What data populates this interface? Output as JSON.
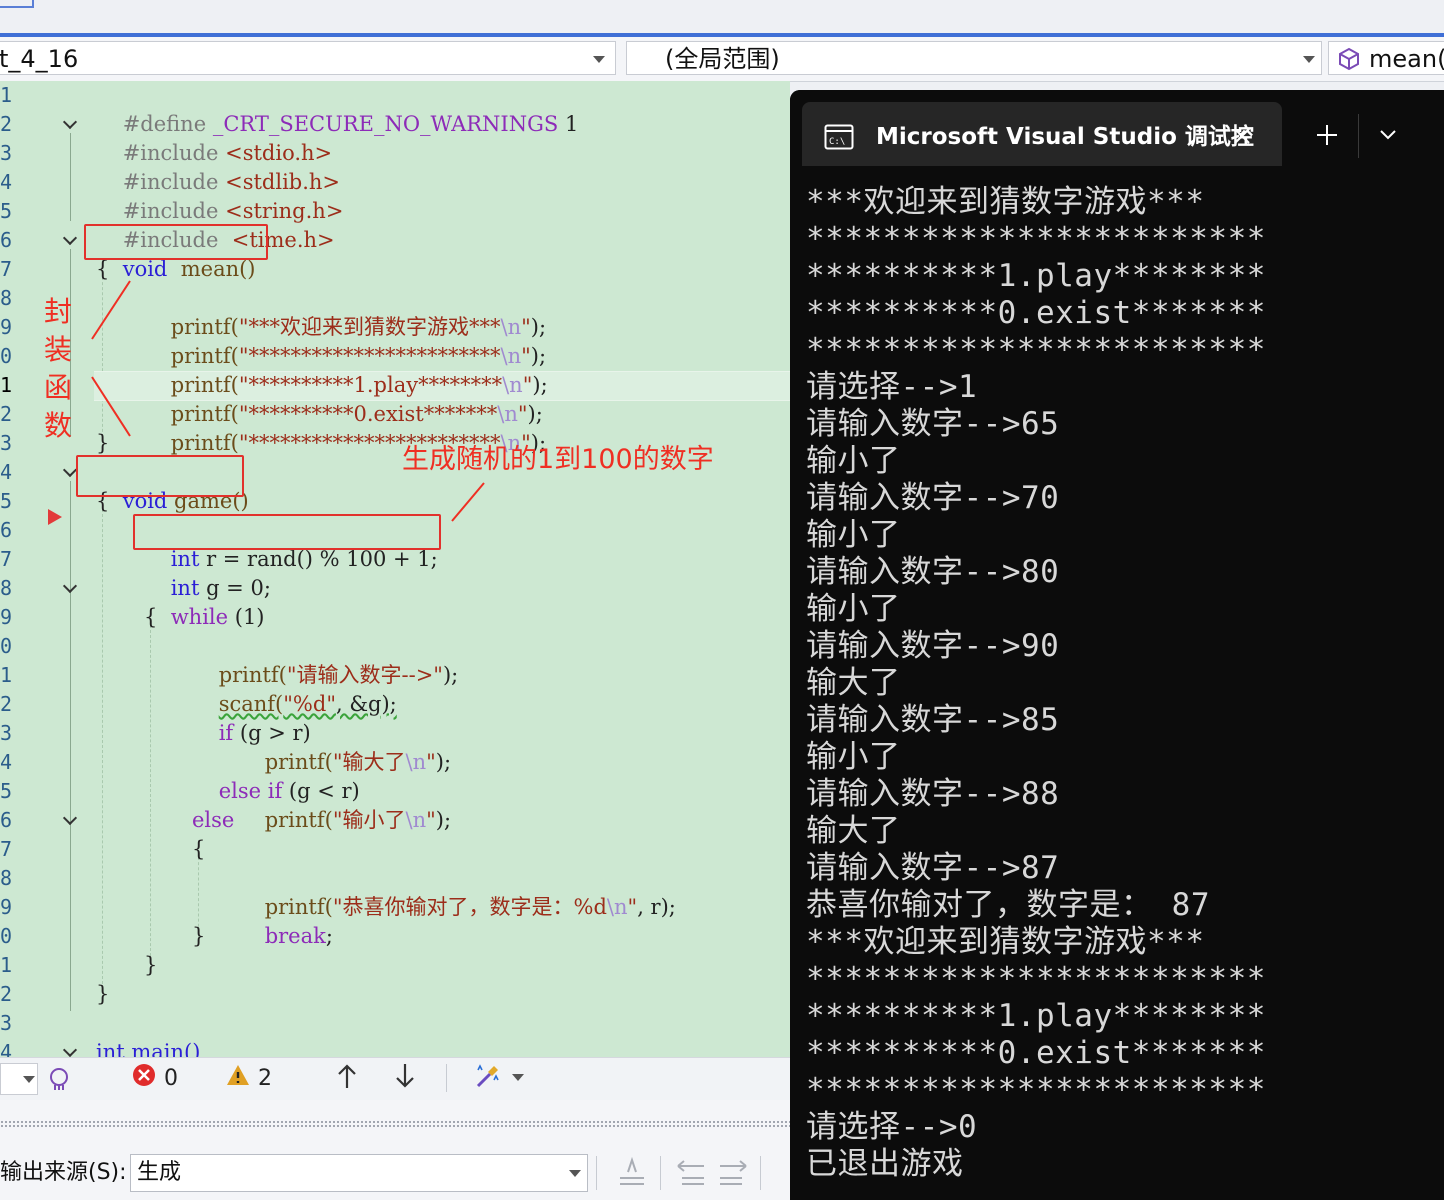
{
  "nav": {
    "project_combo": "t_4_16",
    "scope_combo": "(全局范围)",
    "member_combo": "mean()"
  },
  "editor": {
    "line_numbers": [
      "1",
      "2",
      "3",
      "4",
      "5",
      "6",
      "7",
      "8",
      "9",
      "0",
      "1",
      "2",
      "3",
      "4",
      "5",
      "6",
      "7",
      "8",
      "9",
      "0",
      "1",
      "2",
      "3",
      "4",
      "5",
      "6",
      "7",
      "8",
      "9",
      "0",
      "1",
      "2",
      "3",
      "4"
    ],
    "lines": {
      "l1a": "#define ",
      "l1b": "_CRT_SECURE_NO_WARNINGS",
      "l1c": " 1",
      "l2a": "#include ",
      "l2b": "<stdio.h>",
      "l3a": "#include ",
      "l3b": "<stdlib.h>",
      "l4a": "#include ",
      "l4b": "<string.h>",
      "l5a": "#include ",
      "l5b": " <time.h>",
      "l6a": "void",
      "l6b": "  mean()",
      "l7": "{",
      "l8a": "printf(",
      "l8b": "\"***欢迎来到猜数字游戏***",
      "l8c": "\\n",
      "l8d": "\"",
      "l8e": ");",
      "l9a": "printf(",
      "l9b": "\"************************",
      "l9c": "\\n",
      "l9d": "\"",
      "l9e": ");",
      "l10a": "printf(",
      "l10b": "\"**********1.play********",
      "l10c": "\\n",
      "l10d": "\"",
      "l10e": ");",
      "l11a": "printf(",
      "l11b": "\"**********0.exist*******",
      "l11c": "\\n",
      "l11d": "\"",
      "l11e": ");",
      "l12a": "printf(",
      "l12b": "\"************************",
      "l12c": "\\n",
      "l12d": "\"",
      "l12e": ");",
      "l13": "}",
      "l14a": "void",
      "l14b": " game()",
      "l15": "{",
      "l16a": "int",
      "l16b": " r = rand() % 100 + 1;",
      "l17a": "int",
      "l17b": " g = 0;",
      "l18a": "while",
      "l18b": " (1)",
      "l19": "{",
      "l20a": "printf(",
      "l20b": "\"请输入数字-->\"",
      "l20c": ");",
      "l21a": "scanf(",
      "l21b": "\"%d\"",
      "l21c": ", &g);",
      "l22a": "if",
      "l22b": " (g > r)",
      "l23a": "printf(",
      "l23b": "\"输大了",
      "l23c": "\\n",
      "l23d": "\"",
      "l23e": ");",
      "l24a": "else if",
      "l24b": " (g < r)",
      "l25a": "printf(",
      "l25b": "\"输小了",
      "l25c": "\\n",
      "l25d": "\"",
      "l25e": ");",
      "l26": "else",
      "l27": "{",
      "l28a": "printf(",
      "l28b": "\"恭喜你输对了，数字是：%d",
      "l28c": "\\n",
      "l28d": "\"",
      "l28e": ", r);",
      "l29": "break",
      "l29b": ";",
      "l30": "}",
      "l31": "}",
      "l32": "}",
      "l34": "int main()"
    }
  },
  "annotations": {
    "encapsulate": [
      "封",
      "装",
      "函",
      "数"
    ],
    "random_note": "生成随机的1到100的数字"
  },
  "statusbar": {
    "errors": "0",
    "warnings": "2"
  },
  "output": {
    "source_label": "输出来源(S):",
    "source_value": "生成"
  },
  "console": {
    "title": "Microsoft Visual Studio 调试控",
    "lines": [
      "***欢迎来到猜数字游戏***",
      "************************",
      "**********1.play********",
      "**********0.exist*******",
      "************************",
      "请选择-->1",
      "请输入数字-->65",
      "输小了",
      "请输入数字-->70",
      "输小了",
      "请输入数字-->80",
      "输小了",
      "请输入数字-->90",
      "输大了",
      "请输入数字-->85",
      "输小了",
      "请输入数字-->88",
      "输大了",
      "请输入数字-->87",
      "恭喜你输对了，数字是： 87",
      "***欢迎来到猜数字游戏***",
      "************************",
      "**********1.play********",
      "**********0.exist*******",
      "************************",
      "请选择-->0",
      "已退出游戏"
    ]
  },
  "colors": {
    "editor_bg": "#cde8d2",
    "keyword": "#2b1fd6",
    "string": "#9c2d1a",
    "annotation": "#ef2f23",
    "console_bg": "#0c0c0c"
  }
}
